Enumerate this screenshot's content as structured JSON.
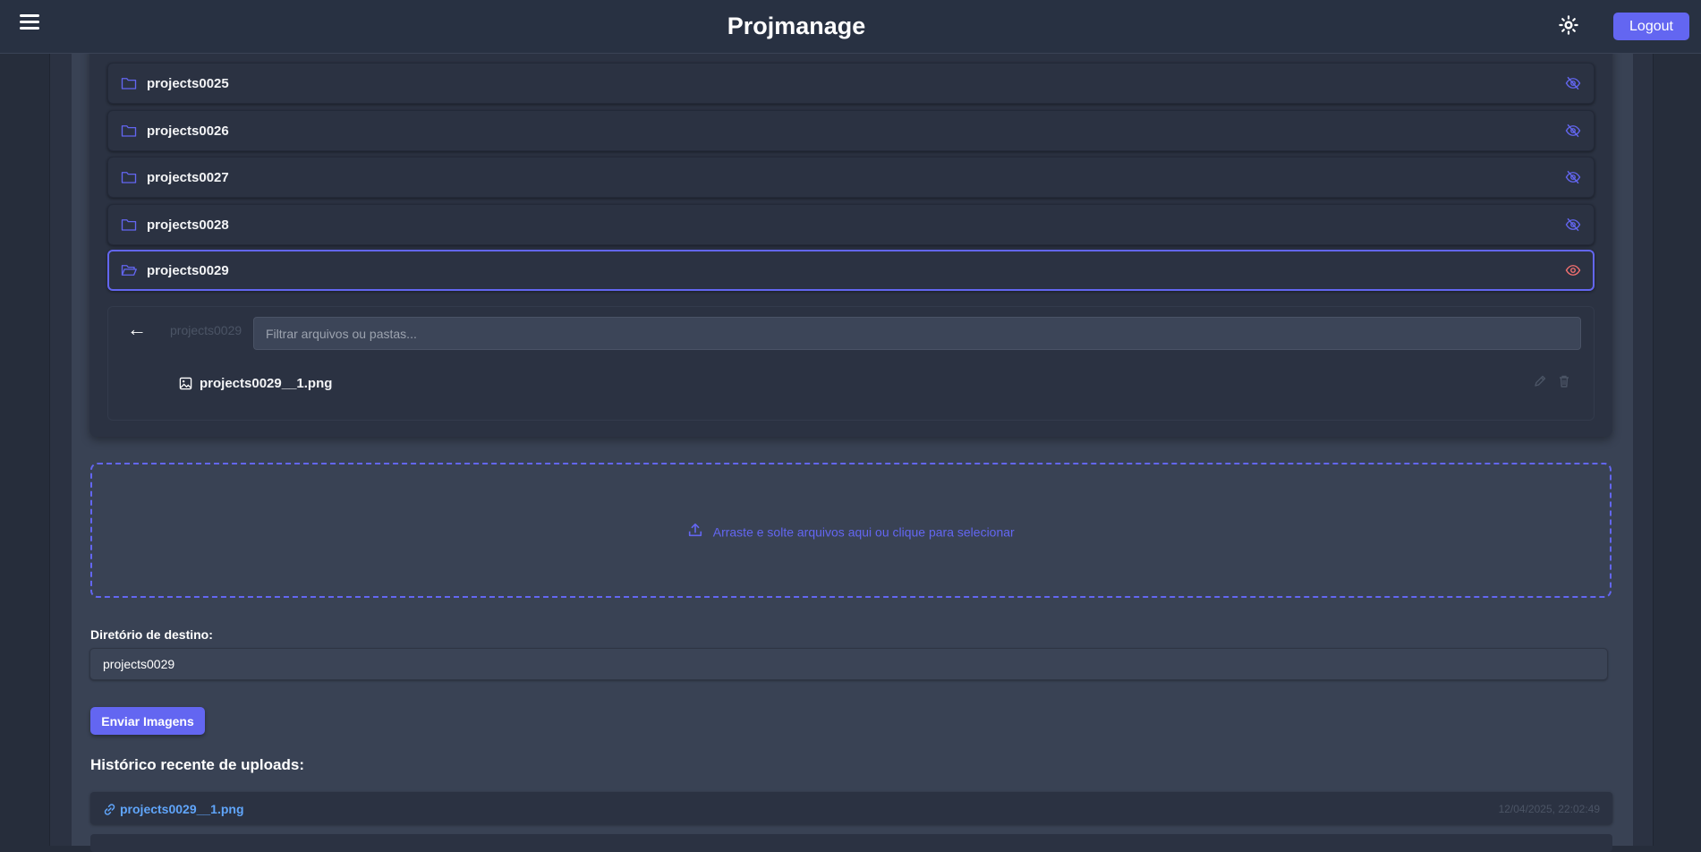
{
  "header": {
    "title": "Projmanage",
    "logout_label": "Logout"
  },
  "folders": [
    {
      "name": "projects0025",
      "visibility_icon": "eye-off-icon",
      "active": false
    },
    {
      "name": "projects0026",
      "visibility_icon": "eye-off-icon",
      "active": false
    },
    {
      "name": "projects0027",
      "visibility_icon": "eye-off-icon",
      "active": false
    },
    {
      "name": "projects0028",
      "visibility_icon": "eye-off-icon",
      "active": false
    },
    {
      "name": "projects0029",
      "visibility_icon": "eye-icon",
      "active": true
    }
  ],
  "subfolder": {
    "breadcrumb": "projects0029",
    "filter_placeholder": "Filtrar arquivos ou pastas...",
    "files": [
      {
        "name": "projects0029__1.png",
        "icon": "image-icon"
      }
    ]
  },
  "dropzone": {
    "text": "Arraste e solte arquivos aqui ou clique para selecionar"
  },
  "destination": {
    "label": "Diretório de destino:",
    "value": "projects0029"
  },
  "send_button_label": "Enviar Imagens",
  "history": {
    "title": "Histórico recente de uploads:",
    "items": [
      {
        "file": "projects0029__1.png",
        "timestamp": "12/04/2025, 22:02:49"
      }
    ]
  },
  "colors": {
    "accent": "#6366f1",
    "link": "#60a5fa",
    "eye_active": "#f87171"
  }
}
